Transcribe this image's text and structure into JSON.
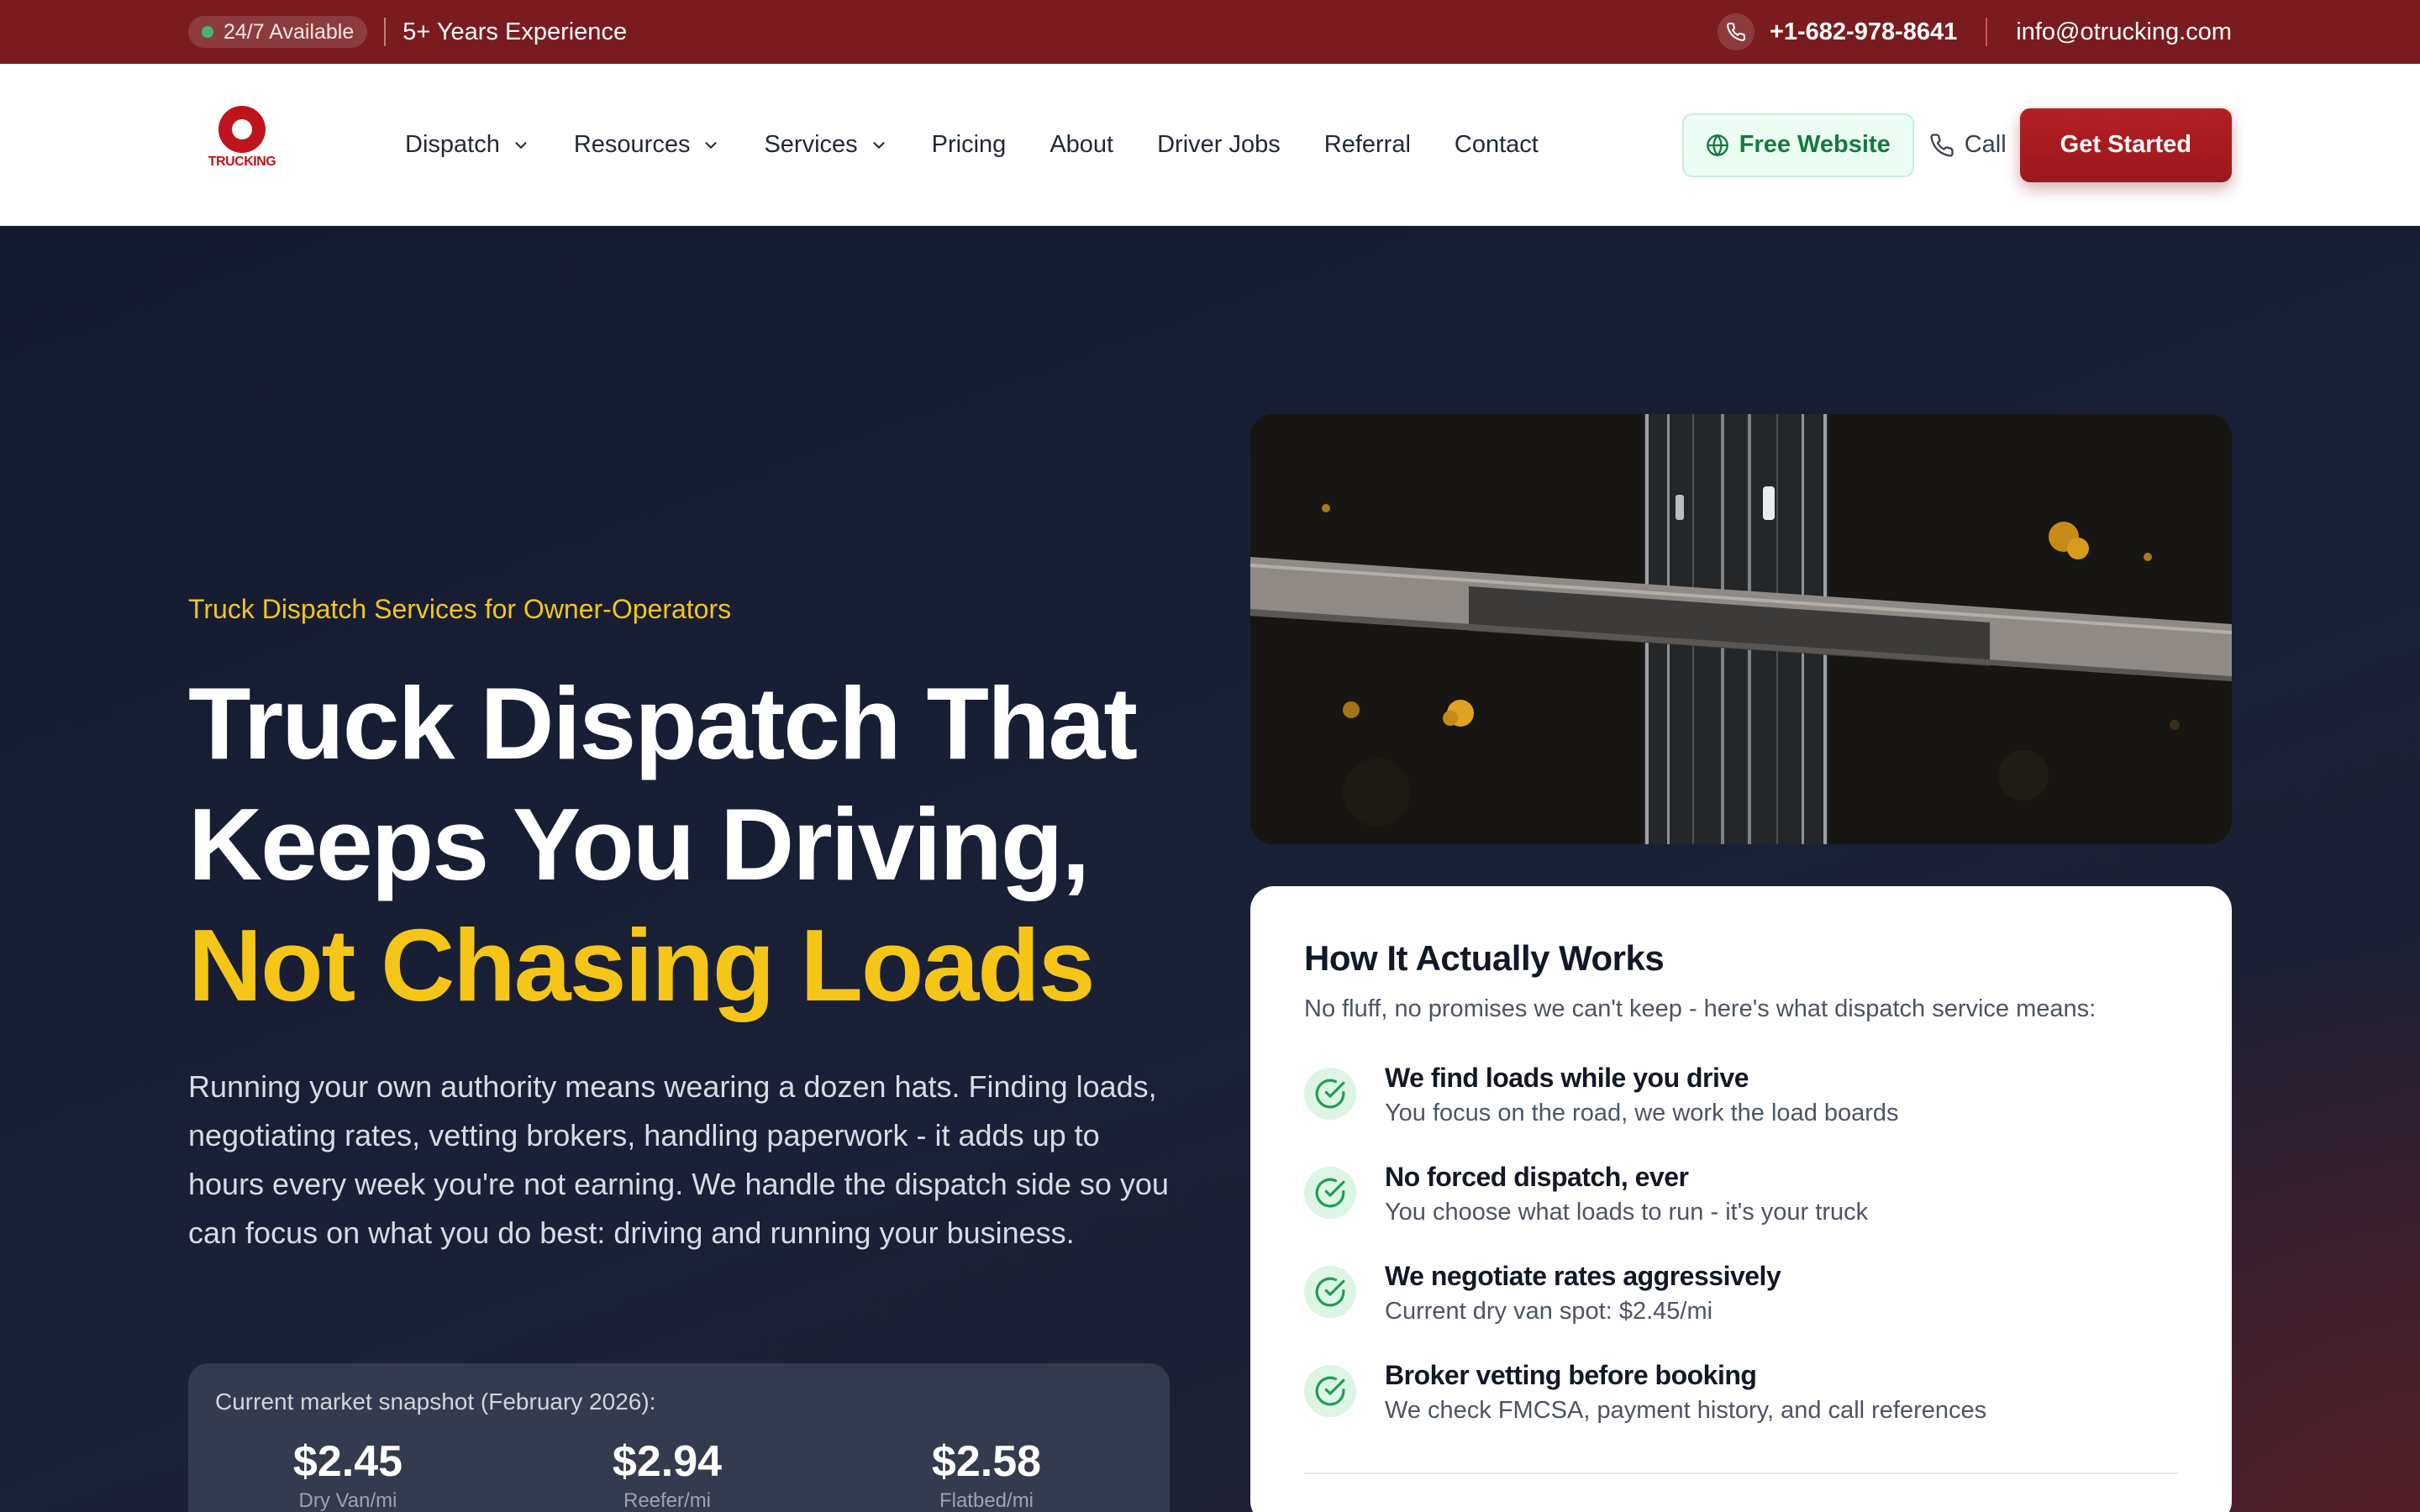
{
  "topbar": {
    "availability": "24/7 Available",
    "experience": "5+ Years Experience",
    "phone": "+1-682-978-8641",
    "email": "info@otrucking.com"
  },
  "nav": {
    "logo_text": "TRUCKING",
    "menu": [
      {
        "label": "Dispatch",
        "has_dropdown": true
      },
      {
        "label": "Resources",
        "has_dropdown": true
      },
      {
        "label": "Services",
        "has_dropdown": true
      },
      {
        "label": "Pricing",
        "has_dropdown": false
      },
      {
        "label": "About",
        "has_dropdown": false
      },
      {
        "label": "Driver Jobs",
        "has_dropdown": false
      },
      {
        "label": "Referral",
        "has_dropdown": false
      },
      {
        "label": "Contact",
        "has_dropdown": false
      }
    ],
    "free_website": "Free Website",
    "call": "Call",
    "get_started": "Get Started"
  },
  "hero": {
    "eyebrow": "Truck Dispatch Services for Owner-Operators",
    "headline_line1": "Truck Dispatch That",
    "headline_line2": "Keeps You Driving,",
    "headline_highlight": "Not Chasing Loads",
    "lead": "Running your own authority means wearing a dozen hats. Finding loads, negotiating rates, vetting brokers, handling paperwork - it adds up to hours every week you're not earning. We handle the dispatch side so you can focus on what you do best: driving and running your business.",
    "snapshot": {
      "title": "Current market snapshot (February 2026):",
      "stats": [
        {
          "value": "$2.45",
          "label": "Dry Van/mi"
        },
        {
          "value": "$2.94",
          "label": "Reefer/mi"
        },
        {
          "value": "$2.58",
          "label": "Flatbed/mi"
        }
      ]
    }
  },
  "how_it_works": {
    "title": "How It Actually Works",
    "subtitle": "No fluff, no promises we can't keep - here's what dispatch service means:",
    "items": [
      {
        "title": "We find loads while you drive",
        "desc": "You focus on the road, we work the load boards"
      },
      {
        "title": "No forced dispatch, ever",
        "desc": "You choose what loads to run - it's your truck"
      },
      {
        "title": "We negotiate rates aggressively",
        "desc": "Current dry van spot: $2.45/mi"
      },
      {
        "title": "Broker vetting before booking",
        "desc": "We check FMCSA, payment history, and call references"
      }
    ]
  },
  "colors": {
    "topbar": "#7a1c1f",
    "brand_red": "#b41f23",
    "accent_yellow": "#f5c518",
    "success_green": "#147a3d"
  },
  "icons": {
    "status": "green-dot-icon",
    "phone": "phone-icon",
    "dropdown": "chevron-down-icon",
    "globe": "globe-icon",
    "check": "check-circle-icon"
  }
}
